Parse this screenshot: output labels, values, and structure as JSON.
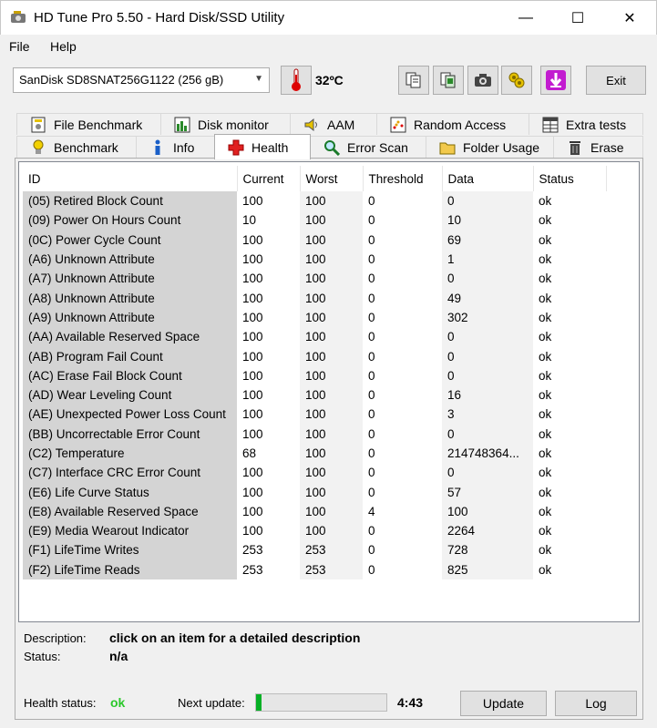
{
  "window": {
    "title": "HD Tune Pro 5.50 - Hard Disk/SSD Utility"
  },
  "menu": {
    "file": "File",
    "help": "Help"
  },
  "toolbar": {
    "drive": "SanDisk SD8SNAT256G1122 (256 gB)",
    "temperature": "32ºC",
    "exit_label": "Exit"
  },
  "tabs_top": [
    {
      "label": "File Benchmark",
      "icon": "file-benchmark-icon"
    },
    {
      "label": "Disk monitor",
      "icon": "disk-monitor-icon"
    },
    {
      "label": "AAM",
      "icon": "speaker-icon"
    },
    {
      "label": "Random Access",
      "icon": "random-access-icon"
    },
    {
      "label": "Extra tests",
      "icon": "extra-tests-icon"
    }
  ],
  "tabs_bottom": [
    {
      "label": "Benchmark",
      "icon": "bulb-icon"
    },
    {
      "label": "Info",
      "icon": "info-icon"
    },
    {
      "label": "Health",
      "icon": "health-cross-icon",
      "active": true
    },
    {
      "label": "Error Scan",
      "icon": "magnifier-icon"
    },
    {
      "label": "Folder Usage",
      "icon": "folder-icon"
    },
    {
      "label": "Erase",
      "icon": "trash-icon"
    }
  ],
  "table": {
    "headers": [
      "ID",
      "Current",
      "Worst",
      "Threshold",
      "Data",
      "Status"
    ],
    "rows": [
      [
        "(05) Retired Block Count",
        "100",
        "100",
        "0",
        "0",
        "ok"
      ],
      [
        "(09) Power On Hours Count",
        "10",
        "100",
        "0",
        "10",
        "ok"
      ],
      [
        "(0C) Power Cycle Count",
        "100",
        "100",
        "0",
        "69",
        "ok"
      ],
      [
        "(A6) Unknown Attribute",
        "100",
        "100",
        "0",
        "1",
        "ok"
      ],
      [
        "(A7) Unknown Attribute",
        "100",
        "100",
        "0",
        "0",
        "ok"
      ],
      [
        "(A8) Unknown Attribute",
        "100",
        "100",
        "0",
        "49",
        "ok"
      ],
      [
        "(A9) Unknown Attribute",
        "100",
        "100",
        "0",
        "302",
        "ok"
      ],
      [
        "(AA) Available Reserved Space",
        "100",
        "100",
        "0",
        "0",
        "ok"
      ],
      [
        "(AB) Program Fail Count",
        "100",
        "100",
        "0",
        "0",
        "ok"
      ],
      [
        "(AC) Erase Fail Block Count",
        "100",
        "100",
        "0",
        "0",
        "ok"
      ],
      [
        "(AD) Wear Leveling Count",
        "100",
        "100",
        "0",
        "16",
        "ok"
      ],
      [
        "(AE) Unexpected Power Loss Count",
        "100",
        "100",
        "0",
        "3",
        "ok"
      ],
      [
        "(BB) Uncorrectable Error Count",
        "100",
        "100",
        "0",
        "0",
        "ok"
      ],
      [
        "(C2) Temperature",
        "68",
        "100",
        "0",
        "214748364...",
        "ok"
      ],
      [
        "(C7) Interface CRC Error Count",
        "100",
        "100",
        "0",
        "0",
        "ok"
      ],
      [
        "(E6) Life Curve Status",
        "100",
        "100",
        "0",
        "57",
        "ok"
      ],
      [
        "(E8) Available Reserved Space",
        "100",
        "100",
        "4",
        "100",
        "ok"
      ],
      [
        "(E9) Media Wearout Indicator",
        "100",
        "100",
        "0",
        "2264",
        "ok"
      ],
      [
        "(F1) LifeTime Writes",
        "253",
        "253",
        "0",
        "728",
        "ok"
      ],
      [
        "(F2) LifeTime Reads",
        "253",
        "253",
        "0",
        "825",
        "ok"
      ]
    ]
  },
  "description": {
    "desc_label": "Description:",
    "desc_value": "click on an item for a detailed description",
    "status_label": "Status:",
    "status_value": "n/a"
  },
  "footer": {
    "health_label": "Health status:",
    "health_value": "ok",
    "next_update_label": "Next update:",
    "progress_fraction": 0.04,
    "timer": "4:43",
    "update_label": "Update",
    "log_label": "Log"
  },
  "colors": {
    "ok_green": "#2bc82b",
    "progress_green": "#06b025"
  }
}
